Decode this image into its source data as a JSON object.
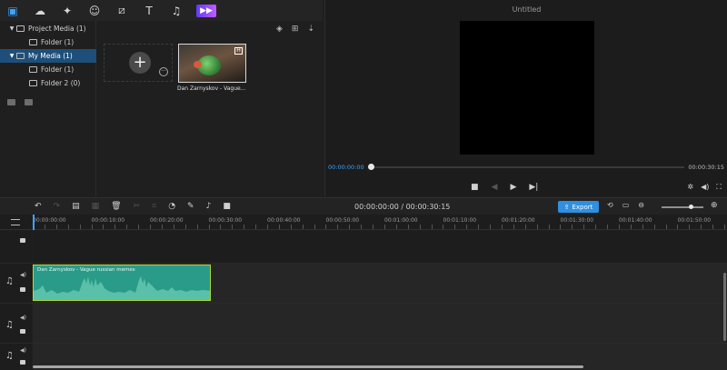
{
  "toolbar": {
    "tools": [
      {
        "icon": "media-icon",
        "glyph": "▣",
        "active": true
      },
      {
        "icon": "stock-media-icon",
        "glyph": "☁",
        "active": false
      },
      {
        "icon": "effects-icon",
        "glyph": "✦",
        "active": false
      },
      {
        "icon": "stickers-icon",
        "glyph": "☺",
        "active": false
      },
      {
        "icon": "transitions-icon",
        "glyph": "⧄",
        "active": false
      },
      {
        "icon": "text-icon",
        "glyph": "T",
        "active": false
      },
      {
        "icon": "audio-icon",
        "glyph": "♫",
        "active": false
      },
      {
        "icon": "brand-icon",
        "glyph": "▶▶",
        "active": false
      }
    ]
  },
  "tree": {
    "items": [
      {
        "label": "Project Media (1)",
        "level": 0,
        "caret": "▼",
        "selected": false
      },
      {
        "label": "Folder (1)",
        "level": 1,
        "caret": "",
        "selected": false
      },
      {
        "label": "My Media (1)",
        "level": 0,
        "caret": "▼",
        "selected": true
      },
      {
        "label": "Folder (1)",
        "level": 1,
        "caret": "",
        "selected": false
      },
      {
        "label": "Folder 2 (0)",
        "level": 1,
        "caret": "",
        "selected": false
      }
    ]
  },
  "bin": {
    "tools": [
      {
        "icon": "layers-icon",
        "glyph": "◈"
      },
      {
        "icon": "grid-view-icon",
        "glyph": "⊞"
      },
      {
        "icon": "sort-icon",
        "glyph": "⇣"
      }
    ],
    "import_symbol": "+",
    "clip_name": "Dan Zarnyskov - Vague..."
  },
  "preview": {
    "title": "Untitled",
    "current_time": "00:00:00:00",
    "total_time": "00:00:30:15",
    "progress": 0,
    "controls": [
      {
        "icon": "stop-icon",
        "glyph": "■",
        "dim": false
      },
      {
        "icon": "prev-frame-icon",
        "glyph": "◀",
        "dim": true
      },
      {
        "icon": "play-icon",
        "glyph": "▶",
        "dim": false
      },
      {
        "icon": "next-frame-icon",
        "glyph": "▶|",
        "dim": false
      }
    ],
    "right_icons": [
      {
        "icon": "settings-icon",
        "glyph": "✲"
      },
      {
        "icon": "volume-icon",
        "glyph": "◀)"
      },
      {
        "icon": "fullscreen-icon",
        "glyph": "⛶"
      }
    ]
  },
  "timeline_toolbar": {
    "tools": [
      {
        "icon": "undo-icon",
        "glyph": "↶",
        "dim": false
      },
      {
        "icon": "redo-icon",
        "glyph": "↷",
        "dim": true
      },
      {
        "icon": "copy-icon",
        "glyph": "▤",
        "dim": false
      },
      {
        "icon": "paste-icon",
        "glyph": "▦",
        "dim": true
      },
      {
        "icon": "delete-icon",
        "glyph": "🗑",
        "dim": false
      },
      {
        "icon": "split-icon",
        "glyph": "✂",
        "dim": true
      },
      {
        "icon": "crop-icon",
        "glyph": "⌗",
        "dim": true
      },
      {
        "icon": "speed-icon",
        "glyph": "◔",
        "dim": false
      },
      {
        "icon": "edit-icon",
        "glyph": "✎",
        "dim": false
      },
      {
        "icon": "microphone-icon",
        "glyph": "♪",
        "dim": false
      },
      {
        "icon": "record-icon",
        "glyph": "■",
        "dim": false
      }
    ],
    "timecode": "00:00:00:00 / 00:00:30:15",
    "export_label": "Export",
    "right_icons": [
      {
        "icon": "loop-icon",
        "glyph": "⟲"
      },
      {
        "icon": "subtitle-icon",
        "glyph": "▭"
      },
      {
        "icon": "zoom-out-icon",
        "glyph": "⊖"
      }
    ],
    "zoom_in_icon": "⊕",
    "zoom_level": 0.7
  },
  "ruler": {
    "marks": [
      "00:00:00:00",
      "00:00:10:00",
      "00:00:20:00",
      "00:00:30:00",
      "00:00:40:00",
      "00:00:50:00",
      "00:01:00:00",
      "00:01:10:00",
      "00:01:20:00",
      "00:01:30:00",
      "00:01:40:00",
      "00:01:50:00"
    ]
  },
  "tracks": {
    "audio_clip_label": "Dan Zarnyskov - Vague russian memes"
  }
}
